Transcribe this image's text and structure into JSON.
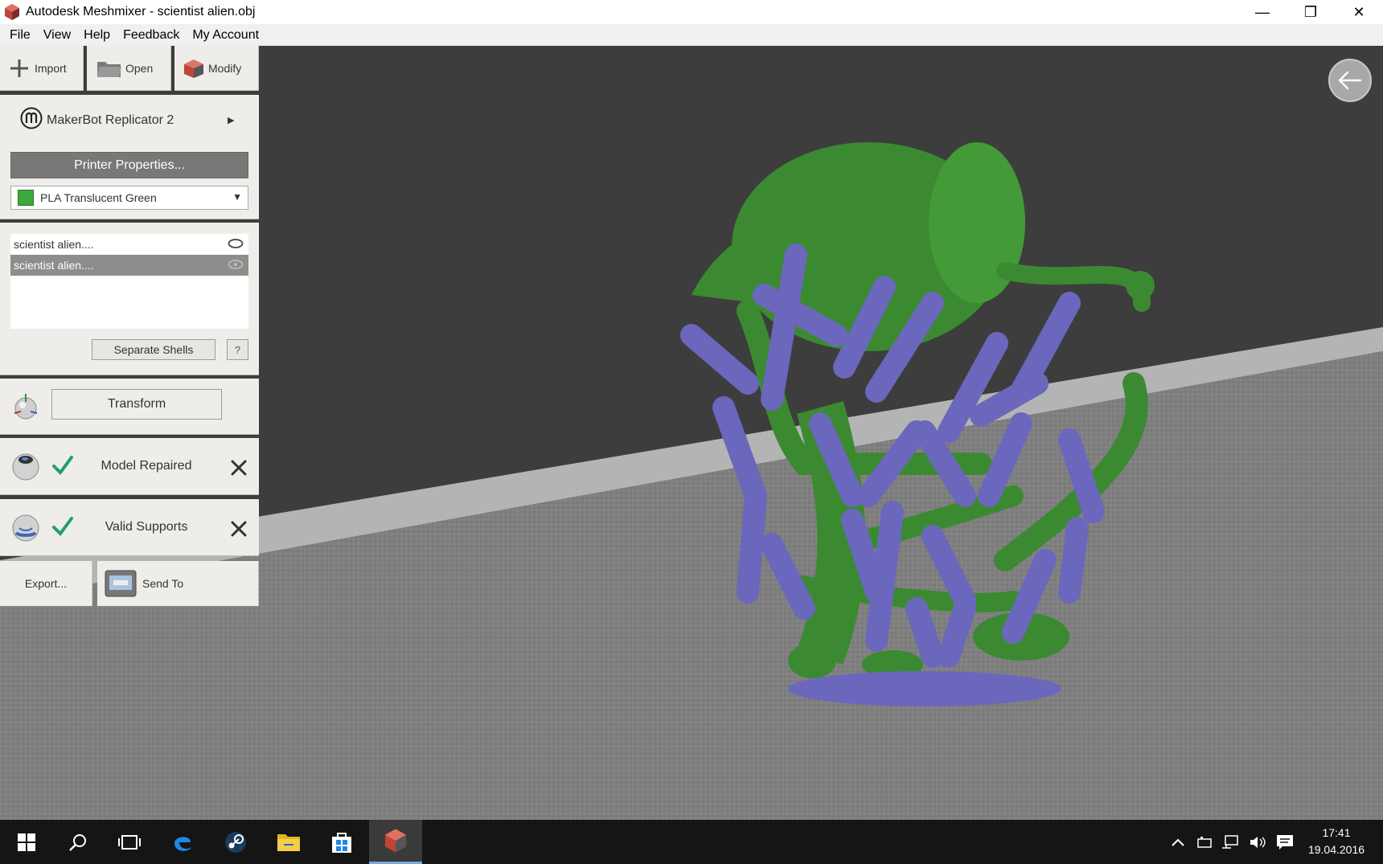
{
  "window": {
    "title": "Autodesk Meshmixer - scientist alien.obj",
    "minimize": "—",
    "restore": "❐",
    "close": "✕"
  },
  "menu": [
    "File",
    "View",
    "Help",
    "Feedback",
    "My Account"
  ],
  "toolbar": {
    "import_label": "Import",
    "open_label": "Open",
    "modify_label": "Modify"
  },
  "printer": {
    "name": "MakerBot Replicator 2",
    "properties_label": "Printer Properties...",
    "material": "PLA Translucent Green",
    "material_color": "#3aa83a"
  },
  "objects": {
    "items": [
      {
        "name": "scientist alien....",
        "selected": false
      },
      {
        "name": "scientist alien....",
        "selected": true
      }
    ],
    "separate_label": "Separate Shells",
    "help_label": "?"
  },
  "transform": {
    "label": "Transform"
  },
  "checks": {
    "repair_label": "Model Repaired",
    "supports_label": "Valid Supports"
  },
  "output": {
    "export_label": "Export...",
    "send_label": "Send To"
  },
  "taskbar": {
    "time": "17:41",
    "date": "19.04.2016"
  },
  "colors": {
    "model_green": "#3c8c32",
    "support_purple": "#6a66b8",
    "check_green": "#1f9e6e"
  }
}
